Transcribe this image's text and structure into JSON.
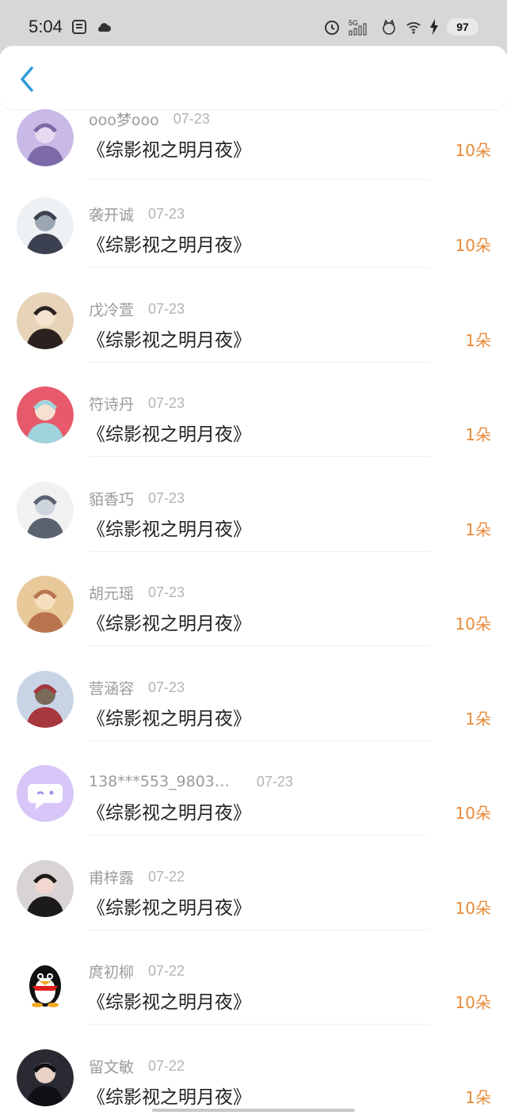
{
  "status_bar": {
    "time": "5:04",
    "network": "5G",
    "battery": "97"
  },
  "header": {
    "back_icon": "chevron-left-icon",
    "accent_color": "#2f9bd6"
  },
  "list": {
    "items": [
      {
        "name": "ooo梦ooo",
        "date": "07-23",
        "title": "《综影视之明月夜》",
        "count": "10朵",
        "avatar": "photo"
      },
      {
        "name": "袭开诚",
        "date": "07-23",
        "title": "《综影视之明月夜》",
        "count": "10朵",
        "avatar": "photo"
      },
      {
        "name": "戊冷萱",
        "date": "07-23",
        "title": "《综影视之明月夜》",
        "count": "1朵",
        "avatar": "photo"
      },
      {
        "name": "符诗丹",
        "date": "07-23",
        "title": "《综影视之明月夜》",
        "count": "1朵",
        "avatar": "photo"
      },
      {
        "name": "貊香巧",
        "date": "07-23",
        "title": "《综影视之明月夜》",
        "count": "1朵",
        "avatar": "illustration"
      },
      {
        "name": "胡元瑶",
        "date": "07-23",
        "title": "《综影视之明月夜》",
        "count": "10朵",
        "avatar": "illustration"
      },
      {
        "name": "营涵容",
        "date": "07-23",
        "title": "《综影视之明月夜》",
        "count": "1朵",
        "avatar": "photo"
      },
      {
        "name": "138***553_9803…",
        "date": "07-23",
        "title": "《综影视之明月夜》",
        "count": "10朵",
        "avatar": "chat-bubble-icon"
      },
      {
        "name": "甫梓露",
        "date": "07-22",
        "title": "《综影视之明月夜》",
        "count": "10朵",
        "avatar": "photo"
      },
      {
        "name": "庹初柳",
        "date": "07-22",
        "title": "《综影视之明月夜》",
        "count": "10朵",
        "avatar": "penguin-icon"
      },
      {
        "name": "留文敏",
        "date": "07-22",
        "title": "《综影视之明月夜》",
        "count": "1朵",
        "avatar": "photo"
      }
    ]
  },
  "colors": {
    "count": "#e98b3a",
    "status_bar_bg": "#d7d7d7",
    "name_text": "#9b9b9b"
  }
}
